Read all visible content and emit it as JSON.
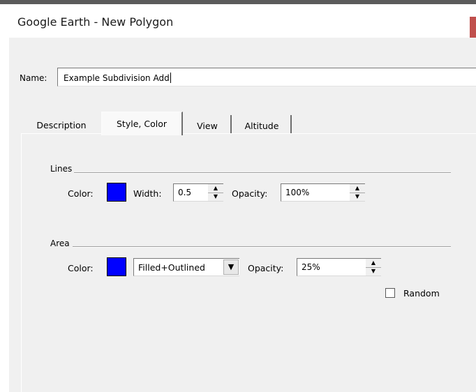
{
  "window": {
    "title": "Google Earth - New Polygon"
  },
  "name": {
    "label": "Name:",
    "value": "Example Subdivision Add"
  },
  "tabs": [
    {
      "label": "Description",
      "selected": false
    },
    {
      "label": "Style, Color",
      "selected": true
    },
    {
      "label": "View",
      "selected": false
    },
    {
      "label": "Altitude",
      "selected": false
    }
  ],
  "lines": {
    "title": "Lines",
    "color_label": "Color:",
    "color": "#0000ff",
    "width_label": "Width:",
    "width": "0.5",
    "opacity_label": "Opacity:",
    "opacity": "100%"
  },
  "area": {
    "title": "Area",
    "color_label": "Color:",
    "color": "#0000ff",
    "fill_mode": "Filled+Outlined",
    "opacity_label": "Opacity:",
    "opacity": "25%",
    "random_label": "Random",
    "random_checked": false
  },
  "icons": {
    "spin_up": "▲",
    "spin_down": "▼",
    "dropdown": "▼"
  }
}
